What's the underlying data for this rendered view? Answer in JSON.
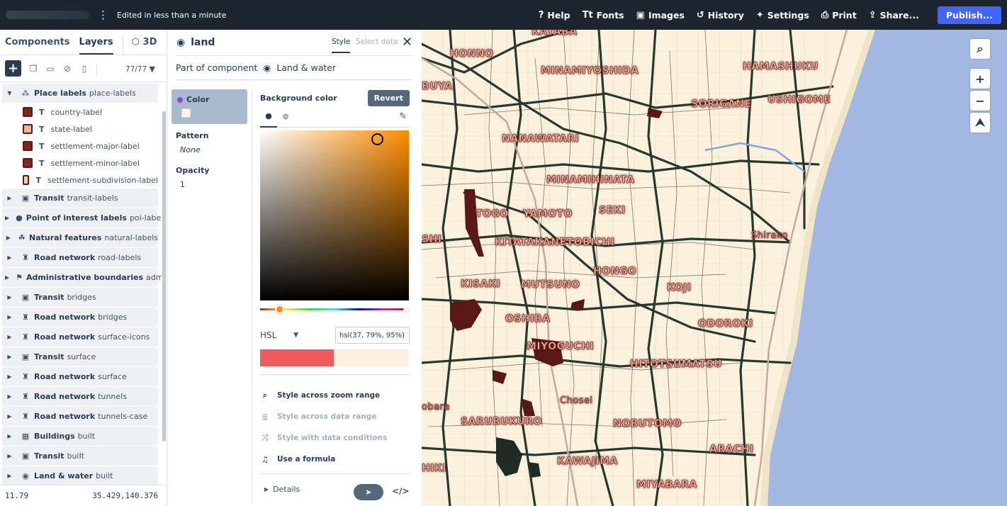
{
  "topbar": {
    "edited": "Edited in less than a minute",
    "items": [
      {
        "label": "Help",
        "icon": "?"
      },
      {
        "label": "Fonts",
        "icon": "Tt"
      },
      {
        "label": "Images",
        "icon": "▣"
      },
      {
        "label": "History",
        "icon": "↺"
      },
      {
        "label": "Settings",
        "icon": "✦"
      },
      {
        "label": "Print",
        "icon": "⎙"
      },
      {
        "label": "Share...",
        "icon": "⇪"
      }
    ],
    "publish": "Publish..."
  },
  "left": {
    "tabs": [
      "Components",
      "Layers",
      "3D"
    ],
    "layer_count": "77/77",
    "layers": [
      {
        "type": "group-open",
        "icon": "place-icon",
        "name": "Place labels",
        "id": "place-labels"
      },
      {
        "type": "child",
        "name": "country-label"
      },
      {
        "type": "child",
        "name": "state-label"
      },
      {
        "type": "child",
        "name": "settlement-major-label"
      },
      {
        "type": "child",
        "name": "settlement-minor-label"
      },
      {
        "type": "child",
        "name": "settlement-subdivision-label"
      },
      {
        "type": "group",
        "icon": "transit-icon",
        "name": "Transit",
        "id": "transit-labels"
      },
      {
        "type": "group",
        "icon": "poi-icon",
        "name": "Point of interest labels",
        "id": "poi-labels"
      },
      {
        "type": "group",
        "icon": "natural-icon",
        "name": "Natural features",
        "id": "natural-labels"
      },
      {
        "type": "group",
        "icon": "road-icon",
        "name": "Road network",
        "id": "road-labels"
      },
      {
        "type": "group",
        "icon": "admin-icon",
        "name": "Administrative boundaries",
        "id": "admin"
      },
      {
        "type": "group",
        "icon": "transit-icon",
        "name": "Transit",
        "id": "bridges"
      },
      {
        "type": "group",
        "icon": "road-icon",
        "name": "Road network",
        "id": "bridges"
      },
      {
        "type": "group",
        "icon": "road-icon",
        "name": "Road network",
        "id": "surface-icons"
      },
      {
        "type": "group",
        "icon": "transit-icon",
        "name": "Transit",
        "id": "surface"
      },
      {
        "type": "group",
        "icon": "road-icon",
        "name": "Road network",
        "id": "surface"
      },
      {
        "type": "group",
        "icon": "road-icon",
        "name": "Road network",
        "id": "tunnels"
      },
      {
        "type": "group",
        "icon": "road-icon",
        "name": "Road network",
        "id": "tunnels-case"
      },
      {
        "type": "group",
        "icon": "buildings-icon",
        "name": "Buildings",
        "id": "built"
      },
      {
        "type": "group",
        "icon": "transit-icon",
        "name": "Transit",
        "id": "built"
      },
      {
        "type": "group",
        "icon": "globe-icon",
        "name": "Land & water",
        "id": "built"
      }
    ],
    "zoom": "11.79",
    "coords": "35.429,140.376"
  },
  "editor": {
    "title": "land",
    "tab_style": "Style",
    "tab_select": "Select data",
    "part_of": "Part of component",
    "component": "Land & water",
    "props": {
      "color_label": "Color",
      "pattern_label": "Pattern",
      "pattern_value": "None",
      "opacity_label": "Opacity",
      "opacity_value": "1"
    },
    "picker": {
      "title": "Background color",
      "revert": "Revert",
      "format": "HSL",
      "value": "hsl(37, 79%, 95%)",
      "old_color": "#f05c5c",
      "new_color": "#fcf0e2"
    },
    "options": [
      {
        "label": "Style across zoom range",
        "enabled": true
      },
      {
        "label": "Style across data range",
        "enabled": false
      },
      {
        "label": "Style with data conditions",
        "enabled": false
      },
      {
        "label": "Use a formula",
        "enabled": true
      }
    ],
    "details": "Details"
  },
  "map": {
    "labels": [
      "KAYABA",
      "HONNO",
      "MINAMIYOSHIDA",
      "HAMASHUKU",
      "SORIGANE",
      "USHIGOME",
      "BUYA",
      "NANAWATARI",
      "MINAMIHINATA",
      "TOGO",
      "YAMOTO",
      "SEKI",
      "Shirako",
      "SHI",
      "KITATAKANETOBICHI",
      "HONGO",
      "KISAKI",
      "MUTSUNO",
      "KOJI",
      "OSHIBA",
      "ODOROKI",
      "MIYOGUCHI",
      "HITOTSUMATSU",
      "Chosei",
      "obara",
      "SARUBUKURO",
      "NOBUTOMO",
      "ARACHI",
      "HIKI",
      "KAWAJIMA",
      "MIYABARA"
    ],
    "colors": {
      "land": "#fbf1dd",
      "water": "#a2b7e2",
      "road": "#25392f",
      "park": "#5a1814"
    }
  }
}
